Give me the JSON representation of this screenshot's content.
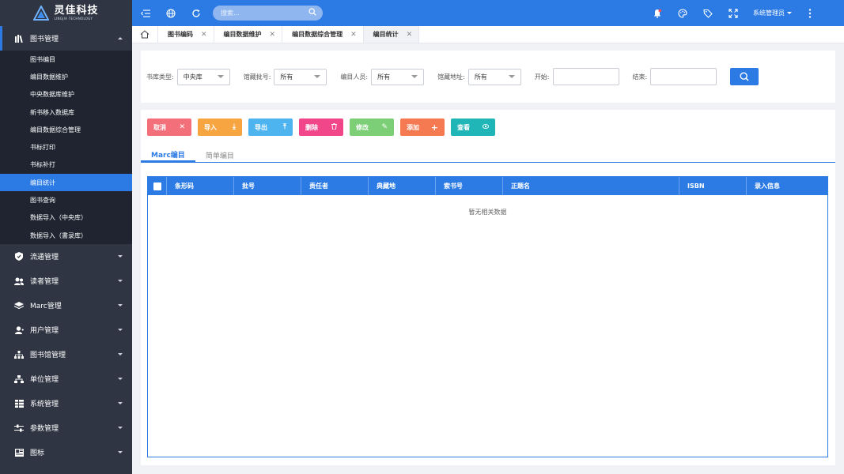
{
  "logo": {
    "name_cn": "灵佳科技",
    "name_en": "LINGJIA TECHNOLOGY"
  },
  "sidebar": {
    "open_group": {
      "label": "图书管理",
      "icon": "book-icon",
      "items": [
        {
          "label": "图书编目",
          "active": false
        },
        {
          "label": "编目数据维护",
          "active": false
        },
        {
          "label": "中央数据库维护",
          "active": false
        },
        {
          "label": "新书移入数据库",
          "active": false
        },
        {
          "label": "编目数据综合管理",
          "active": false
        },
        {
          "label": "书标打印",
          "active": false
        },
        {
          "label": "书标补打",
          "active": false
        },
        {
          "label": "编目统计",
          "active": true
        },
        {
          "label": "图书查询",
          "active": false
        },
        {
          "label": "数据导入（中央库）",
          "active": false
        },
        {
          "label": "数据导入（書录库）",
          "active": false
        }
      ]
    },
    "groups": [
      {
        "label": "流通管理",
        "icon": "shield-icon"
      },
      {
        "label": "读者管理",
        "icon": "users-icon"
      },
      {
        "label": "Marc管理",
        "icon": "layers-icon"
      },
      {
        "label": "用户管理",
        "icon": "user-icon"
      },
      {
        "label": "图书馆管理",
        "icon": "sitemap-icon"
      },
      {
        "label": "单位管理",
        "icon": "org-icon"
      },
      {
        "label": "系统管理",
        "icon": "grid-icon"
      },
      {
        "label": "参数管理",
        "icon": "sliders-icon"
      },
      {
        "label": "图标",
        "icon": "image-icon"
      }
    ]
  },
  "topbar": {
    "search_placeholder": "搜索...",
    "user_name": "系统管理员"
  },
  "tabs": [
    {
      "label": "图书编码",
      "active": false
    },
    {
      "label": "编目数据维护",
      "active": false
    },
    {
      "label": "编目数据综合管理",
      "active": false
    },
    {
      "label": "编目统计",
      "active": true
    }
  ],
  "filters": {
    "library_type": {
      "label": "书库类型:",
      "value": "中央库"
    },
    "batch": {
      "label": "馆藏批号:",
      "value": "所有"
    },
    "cataloger": {
      "label": "编目人员:",
      "value": "所有"
    },
    "location": {
      "label": "馆藏地址:",
      "value": "所有"
    },
    "start": {
      "label": "开始:"
    },
    "end": {
      "label": "结束:"
    }
  },
  "actions": [
    {
      "label": "取消",
      "icon": "✕",
      "color": "#f36f7a"
    },
    {
      "label": "导入",
      "icon": "⤓",
      "color": "#f7a540"
    },
    {
      "label": "导出",
      "icon": "⤒",
      "color": "#4eb4ef"
    },
    {
      "label": "删除",
      "icon": "🗑",
      "color": "#f2468a"
    },
    {
      "label": "修改",
      "icon": "✎",
      "color": "#7ccf76"
    },
    {
      "label": "添加",
      "icon": "+",
      "color": "#f57a52"
    },
    {
      "label": "查看",
      "icon": "◉",
      "color": "#20b6b8"
    }
  ],
  "subtabs": [
    {
      "label": "Marc编目",
      "active": true
    },
    {
      "label": "简单编目",
      "active": false
    }
  ],
  "table": {
    "columns": [
      "条形码",
      "批号",
      "责任者",
      "典藏地",
      "索书号",
      "正题名",
      "ISBN",
      "录入信息"
    ],
    "empty_text": "暂无相关数据"
  },
  "colors": {
    "primary": "#2c7be5",
    "sidebar": "#2f3542",
    "submenu": "#1f2430"
  }
}
